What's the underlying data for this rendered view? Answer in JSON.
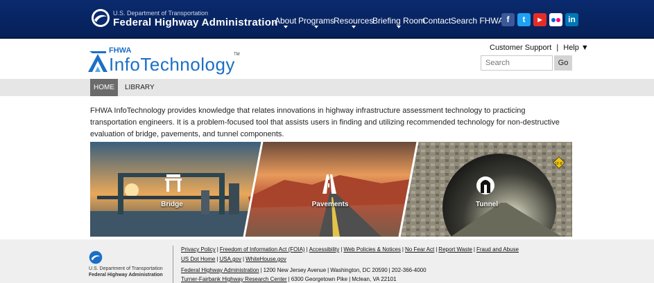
{
  "topbar": {
    "dot_small": "U.S. Department of Transportation",
    "dot_big": "Federal Highway Administration",
    "nav": [
      {
        "label": "About",
        "dropdown": true
      },
      {
        "label": "Programs",
        "dropdown": true
      },
      {
        "label": "Resources",
        "dropdown": true
      },
      {
        "label": "Briefing Room",
        "dropdown": true
      },
      {
        "label": "Contact",
        "dropdown": false
      },
      {
        "label": "Search FHWA",
        "dropdown": false
      }
    ],
    "social": [
      {
        "name": "facebook-icon",
        "glyph": "f",
        "color": "#3b5998"
      },
      {
        "name": "twitter-icon",
        "glyph": "t",
        "color": "#1da1f2"
      },
      {
        "name": "youtube-icon",
        "glyph": "▶",
        "color": "#e52d27"
      },
      {
        "name": "flickr-icon",
        "glyph": "●●",
        "color": "#0063dc"
      },
      {
        "name": "linkedin-icon",
        "glyph": "in",
        "color": "#0077b5"
      }
    ]
  },
  "header": {
    "logo_top": "FHWA",
    "logo_main": "InfoTechnology",
    "logo_tm": "TM",
    "customer_support": "Customer Support",
    "help_sep": "|",
    "help": "Help ▼",
    "search_placeholder": "Search",
    "go": "Go"
  },
  "nav": {
    "home": "HOME",
    "library": "LIBRARY"
  },
  "intro": "FHWA InfoTechnology provides knowledge that relates innovations in highway infrastructure assessment technology to practicing transportation engineers. It is a problem-focused tool that assists users in finding and utilizing recommended technology for non-destructive evaluation of bridge, pavements, and tunnel components.",
  "hero": {
    "bridge": "Bridge",
    "pavements": "Pavements",
    "tunnel": "Tunnel",
    "sign": "13'-6\""
  },
  "footer": {
    "org1": "U.S. Department of Transportation",
    "org2": "Federal Highway Administration",
    "line1": [
      "Privacy Policy",
      "Freedom of Information Act (FOIA)",
      "Accessibility",
      "Web Policies & Notices",
      "No Fear Act",
      "Report Waste",
      "Fraud and Abuse"
    ],
    "line2": [
      "US Dot Home",
      "USA.gov",
      "WhiteHouse.gov"
    ],
    "line3_link": "Federal Highway Administration",
    "line3_rest": [
      "1200 New Jersey Avenue",
      "Washington, DC 20590",
      "202-366-4000"
    ],
    "line4_link": "Turner-Fairbank Highway Research Center",
    "line4_rest": [
      "6300 Georgetown Pike",
      "Mclean, VA 22101"
    ]
  },
  "colors": {
    "topbar": "#0a2a6e",
    "nav_active": "#6b6b6b",
    "logo_blue": "#1b6fc6"
  }
}
